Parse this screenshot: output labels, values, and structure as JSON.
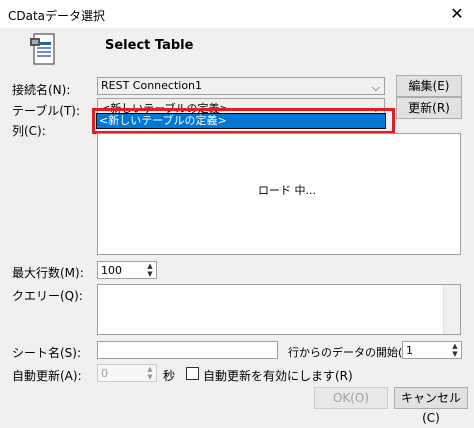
{
  "window": {
    "title": "CDataデータ選択",
    "close_glyph": "✕"
  },
  "header": {
    "heading": "Select Table",
    "icon": "table-document-icon"
  },
  "connection": {
    "label": "接続名(N):",
    "value": "REST Connection1",
    "edit_label": "編集(E)"
  },
  "table": {
    "label": "テーブル(T):",
    "value": "<新しいテーブルの定義>",
    "refresh_label": "更新(R)",
    "dropdown_option": "<新しいテーブルの定義>"
  },
  "columns": {
    "label": "列(C):",
    "loading_text": "ロード 中..."
  },
  "max_rows": {
    "label": "最大行数(M):",
    "value": "100"
  },
  "query": {
    "label": "クエリー(Q):",
    "value": ""
  },
  "sheet": {
    "label": "シート名(S):",
    "value": "",
    "start_row_label": "行からのデータの開始(S):",
    "start_row_value": "1"
  },
  "auto_refresh": {
    "label": "自動更新(A):",
    "value": "0",
    "unit": "秒",
    "enable_label": "自動更新を有効にします(R)"
  },
  "footer": {
    "ok_label": "OK(O)",
    "cancel_label": "キャンセル(C)"
  },
  "colors": {
    "highlight": "#0078d7",
    "annotation_border": "#e02020"
  }
}
